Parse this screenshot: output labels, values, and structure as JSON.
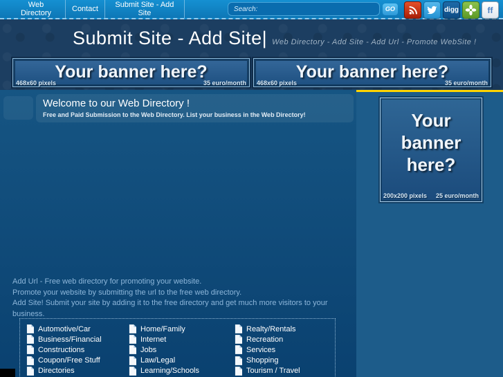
{
  "nav": {
    "items": [
      {
        "label": "Web Directory"
      },
      {
        "label": "Contact"
      },
      {
        "label": "Submit Site - Add Site"
      }
    ],
    "search_placeholder": "Search:",
    "go_label": "GO",
    "social": {
      "digg_label": "digg",
      "friendfeed_label": "ff"
    }
  },
  "header": {
    "title": "Submit Site - Add Site|",
    "tagline": "Web Directory - Add Site - Add Url - Promote WebSite !"
  },
  "banners": {
    "top_left": {
      "headline": "Your banner here?",
      "size": "468x60 pixels",
      "price": "35 euro/month"
    },
    "top_right": {
      "headline": "Your banner here?",
      "size": "468x60 pixels",
      "price": "35 euro/month"
    },
    "side": {
      "line1": "Your",
      "line2": "banner",
      "line3": "here?",
      "size": "200x200 pixels",
      "price": "25 euro/month"
    }
  },
  "welcome": {
    "title": "Welcome to our Web Directory !",
    "subtitle": "Free and Paid Submission to the Web Directory. List your business in the Web Directory!"
  },
  "intro": {
    "line1": "Add Url - Free web directory for promoting your website.",
    "line2": "Promote your website by submitting the url to the free web directory.",
    "line3": "Add Site! Submit your site by adding it to the free directory and get much more visitors to your business."
  },
  "categories": {
    "columns": [
      [
        "Automotive/Car",
        "Business/Financial",
        "Constructions",
        "Coupon/Free Stuff",
        "Directories"
      ],
      [
        "Home/Family",
        "Internet",
        "Jobs",
        "Law/Legal",
        "Learning/Schools"
      ],
      [
        "Realty/Rentals",
        "Recreation",
        "Services",
        "Shopping",
        "Tourism / Travel"
      ]
    ]
  },
  "colors": {
    "accent_yellow": "#ffd400",
    "nav_blue": "#1184c6",
    "band_navy": "#1c3e61",
    "main_top": "#165583",
    "main_bottom": "#0a4170",
    "sidebar_blue": "#1d5c8a",
    "rss_red": "#cc2b12",
    "twitter_blue": "#36a4e0",
    "digg_navy": "#14578f",
    "share_green": "#76b33e",
    "friendfeed_blue": "#4a7fc1"
  }
}
